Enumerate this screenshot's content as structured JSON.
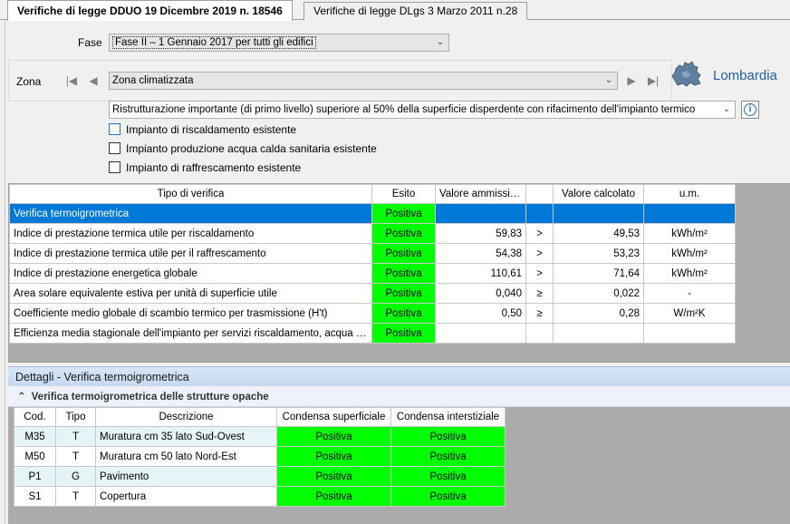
{
  "tabs": [
    {
      "label": "Verifiche di legge DDUO 19 Dicembre 2019 n. 18546",
      "active": true
    },
    {
      "label": "Verifiche di legge DLgs 3 Marzo 2011 n.28",
      "active": false
    }
  ],
  "fase": {
    "label": "Fase",
    "value": "Fase II –  1 Gennaio 2017 per tutti gli edifici"
  },
  "zona": {
    "label": "Zona",
    "value": "Zona climatizzata",
    "region": "Lombardia",
    "nav": {
      "first": "|◀",
      "prev": "◀",
      "next": "▶",
      "last": "▶|"
    }
  },
  "intervento": {
    "value": "Ristrutturazione importante (di primo livello) superiore al 50% della superficie disperdente con rifacimento dell'impianto termico"
  },
  "checkboxes": [
    {
      "label": "Impianto di riscaldamento esistente",
      "checked": false
    },
    {
      "label": "Impianto produzione acqua calda sanitaria esistente",
      "checked": false
    },
    {
      "label": "Impianto di raffrescamento esistente",
      "checked": false
    }
  ],
  "verifiche": {
    "headers": [
      "Tipo di verifica",
      "Esito",
      "Valore ammissibile",
      "",
      "Valore calcolato",
      "u.m."
    ],
    "rows": [
      {
        "tipo": "Verifica termoigrometrica",
        "esito": "Positiva",
        "amm": "",
        "op": "",
        "calc": "",
        "um": "",
        "selected": true
      },
      {
        "tipo": "Indice di prestazione termica utile per riscaldamento",
        "esito": "Positiva",
        "amm": "59,83",
        "op": ">",
        "calc": "49,53",
        "um": "kWh/m²"
      },
      {
        "tipo": "Indice di prestazione termica utile per il raffrescamento",
        "esito": "Positiva",
        "amm": "54,38",
        "op": ">",
        "calc": "53,23",
        "um": "kWh/m²"
      },
      {
        "tipo": "Indice di prestazione energetica globale",
        "esito": "Positiva",
        "amm": "110,61",
        "op": ">",
        "calc": "71,64",
        "um": "kWh/m²"
      },
      {
        "tipo": "Area solare equivalente estiva per unità di superficie utile",
        "esito": "Positiva",
        "amm": "0,040",
        "op": "≥",
        "calc": "0,022",
        "um": "-"
      },
      {
        "tipo": "Coefficiente medio globale di scambio termico per trasmissione (H't)",
        "esito": "Positiva",
        "amm": "0,50",
        "op": "≥",
        "calc": "0,28",
        "um": "W/m²K"
      },
      {
        "tipo": "Efficienza media stagionale dell'impianto per servizi riscaldamento, acqua calda s...",
        "esito": "Positiva",
        "amm": "",
        "op": "",
        "calc": "",
        "um": ""
      }
    ]
  },
  "dettagli": {
    "title": "Dettagli - Verifica termoigrometrica",
    "subtitle": "Verifica termoigrometrica delle strutture opache",
    "headers": [
      "Cod.",
      "Tipo",
      "Descrizione",
      "Condensa superficiale",
      "Condensa interstiziale"
    ],
    "rows": [
      {
        "cod": "M35",
        "tipo": "T",
        "desc": "Muratura cm 35 lato Sud-Ovest",
        "sup": "Positiva",
        "int": "Positiva"
      },
      {
        "cod": "M50",
        "tipo": "T",
        "desc": "Muratura cm 50 lato Nord-Est",
        "sup": "Positiva",
        "int": "Positiva"
      },
      {
        "cod": "P1",
        "tipo": "G",
        "desc": "Pavimento",
        "sup": "Positiva",
        "int": "Positiva"
      },
      {
        "cod": "S1",
        "tipo": "T",
        "desc": "Copertura",
        "sup": "Positiva",
        "int": "Positiva"
      }
    ]
  },
  "colors": {
    "positive": "#00ff00",
    "selection": "#0078d7",
    "accent": "#1e5fa8"
  }
}
